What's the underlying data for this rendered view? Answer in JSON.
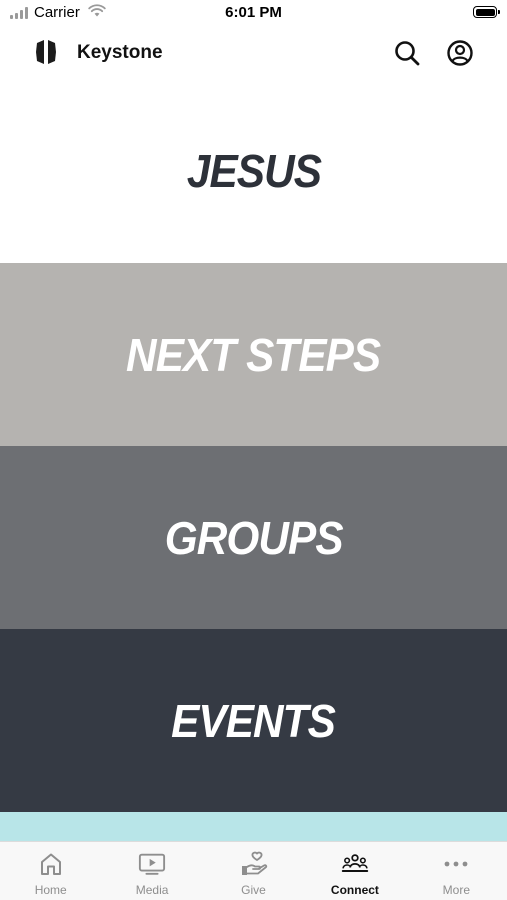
{
  "status_bar": {
    "carrier": "Carrier",
    "time": "6:01 PM"
  },
  "header": {
    "title": "Keystone",
    "logo_icon": "keystone-logo-icon",
    "actions": [
      "search-icon",
      "profile-icon"
    ]
  },
  "tiles": [
    {
      "label": "JESUS",
      "bg": "#ffffff",
      "text_color": "#2d3139"
    },
    {
      "label": "NEXT STEPS",
      "bg": "#b5b3b0",
      "text_color": "#ffffff"
    },
    {
      "label": "GROUPS",
      "bg": "#6d6f73",
      "text_color": "#ffffff"
    },
    {
      "label": "EVENTS",
      "bg": "#353a44",
      "text_color": "#ffffff"
    },
    {
      "label": "",
      "bg": "#b8e5e8",
      "text_color": "#ffffff"
    }
  ],
  "tab_bar": {
    "active": "Connect",
    "items": [
      {
        "label": "Home",
        "icon": "home-icon"
      },
      {
        "label": "Media",
        "icon": "media-icon"
      },
      {
        "label": "Give",
        "icon": "give-icon"
      },
      {
        "label": "Connect",
        "icon": "connect-icon"
      },
      {
        "label": "More",
        "icon": "more-icon"
      }
    ]
  }
}
